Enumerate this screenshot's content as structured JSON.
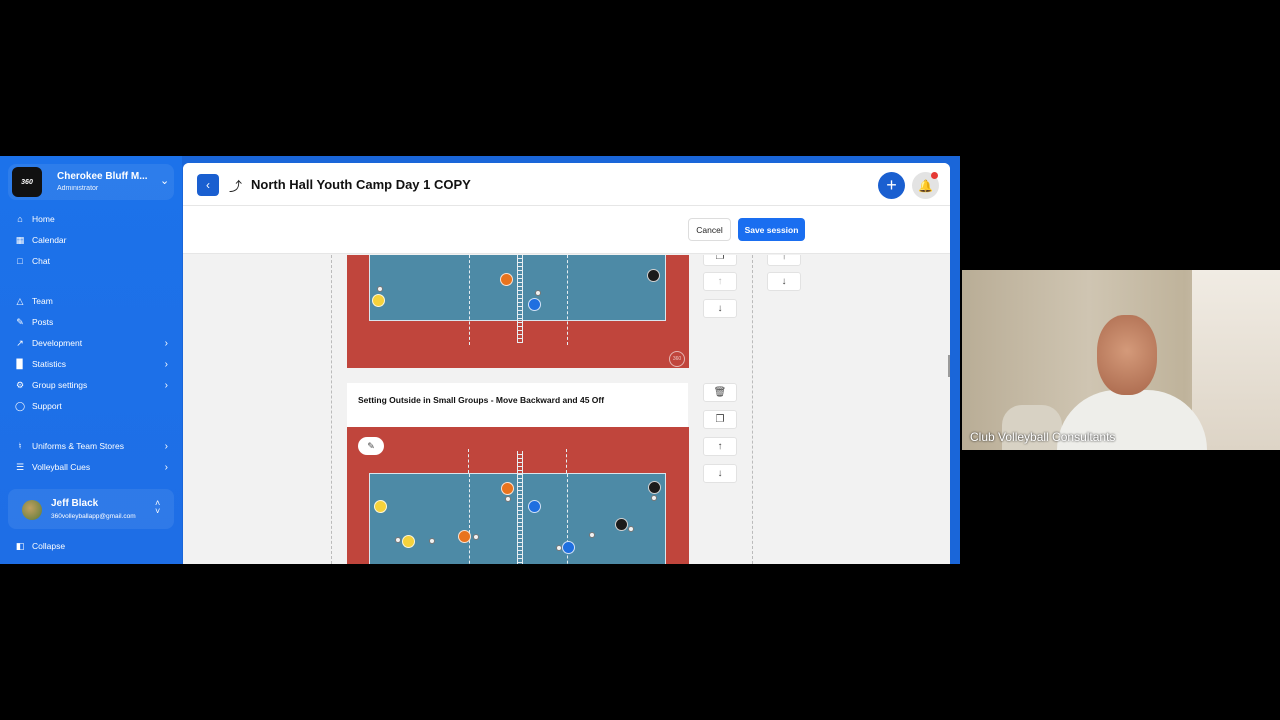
{
  "org": {
    "logo_text": "360",
    "name": "Cherokee Bluff M...",
    "role": "Administrator"
  },
  "nav": {
    "home": "Home",
    "calendar": "Calendar",
    "chat": "Chat",
    "team": "Team",
    "posts": "Posts",
    "development": "Development",
    "statistics": "Statistics",
    "group_settings": "Group settings",
    "support": "Support",
    "uniforms": "Uniforms & Team Stores",
    "volleyball_cues": "Volleyball Cues",
    "collapse": "Collapse"
  },
  "user": {
    "name": "Jeff Black",
    "email": "360volleyballapp@gmail.com"
  },
  "header": {
    "title": "North Hall Youth Camp Day 1 COPY"
  },
  "actions": {
    "cancel": "Cancel",
    "save": "Save session"
  },
  "drill": {
    "title": "Setting Outside in Small Groups - Move Backward and 45 Off"
  },
  "video": {
    "participant": "Club Volleyball Consultants"
  },
  "colors": {
    "brand": "#1a5fd0",
    "court_out": "#c0453c",
    "court_in": "#4d8aa6",
    "yellow": "#f5d23c",
    "orange": "#e8731e",
    "blue": "#1f6fe0",
    "black": "#1b1b1b"
  },
  "icons": [
    "home-icon",
    "calendar-icon",
    "chat-icon",
    "team-icon",
    "posts-icon",
    "development-icon",
    "statistics-icon",
    "group-settings-icon",
    "support-icon",
    "uniforms-icon",
    "cues-icon",
    "collapse-icon",
    "back-icon",
    "session-icon",
    "add-icon",
    "bell-icon",
    "trash-icon",
    "copy-icon",
    "arrow-up-icon",
    "arrow-down-icon",
    "edit-icon"
  ]
}
